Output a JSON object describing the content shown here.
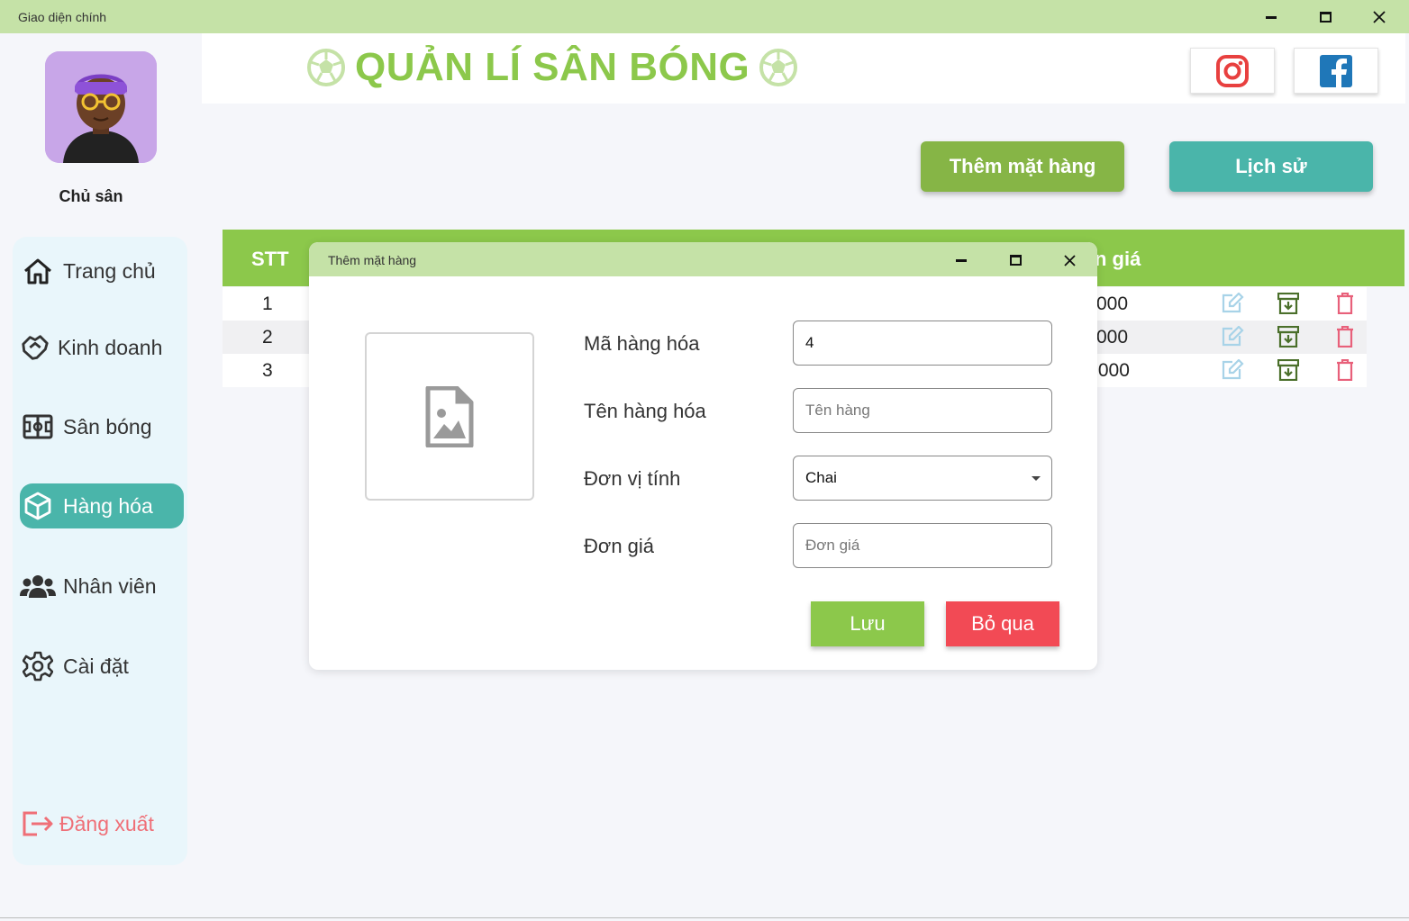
{
  "window": {
    "title": "Giao diện chính"
  },
  "header": {
    "title": "QUẢN LÍ SÂN BÓNG"
  },
  "user": {
    "name": "Chủ sân"
  },
  "sidebar": {
    "items": [
      {
        "label": "Trang chủ",
        "icon": "home-icon"
      },
      {
        "label": "Kinh doanh",
        "icon": "handshake-icon"
      },
      {
        "label": "Sân bóng",
        "icon": "field-icon"
      },
      {
        "label": "Hàng hóa",
        "icon": "box-icon",
        "active": true
      },
      {
        "label": "Nhân viên",
        "icon": "users-icon"
      },
      {
        "label": "Cài đặt",
        "icon": "gear-icon"
      }
    ],
    "logout": "Đăng xuất"
  },
  "actions": {
    "add": "Thêm mặt hàng",
    "history": "Lịch sử"
  },
  "table": {
    "headers": {
      "stt": "STT",
      "price_partial": "n giá"
    },
    "rows": [
      {
        "stt": "1",
        "price_partial": "000"
      },
      {
        "stt": "2",
        "price_partial": "000"
      },
      {
        "stt": "3",
        "price_partial": ",000"
      }
    ]
  },
  "dialog": {
    "title": "Thêm mặt hàng",
    "fields": {
      "code": {
        "label": "Mã hàng hóa",
        "value": "4"
      },
      "name": {
        "label": "Tên hàng hóa",
        "placeholder": "Tên hàng"
      },
      "unit": {
        "label": "Đơn vị tính",
        "value": "Chai"
      },
      "price": {
        "label": "Đơn giá",
        "placeholder": "Đơn giá"
      }
    },
    "save": "Lưu",
    "skip": "Bỏ qua"
  },
  "colors": {
    "accent_green": "#8cc84b",
    "title_bar": "#c5e2a7",
    "teal": "#4ab5aa",
    "danger": "#f24a55",
    "logout": "#ef6f77"
  }
}
